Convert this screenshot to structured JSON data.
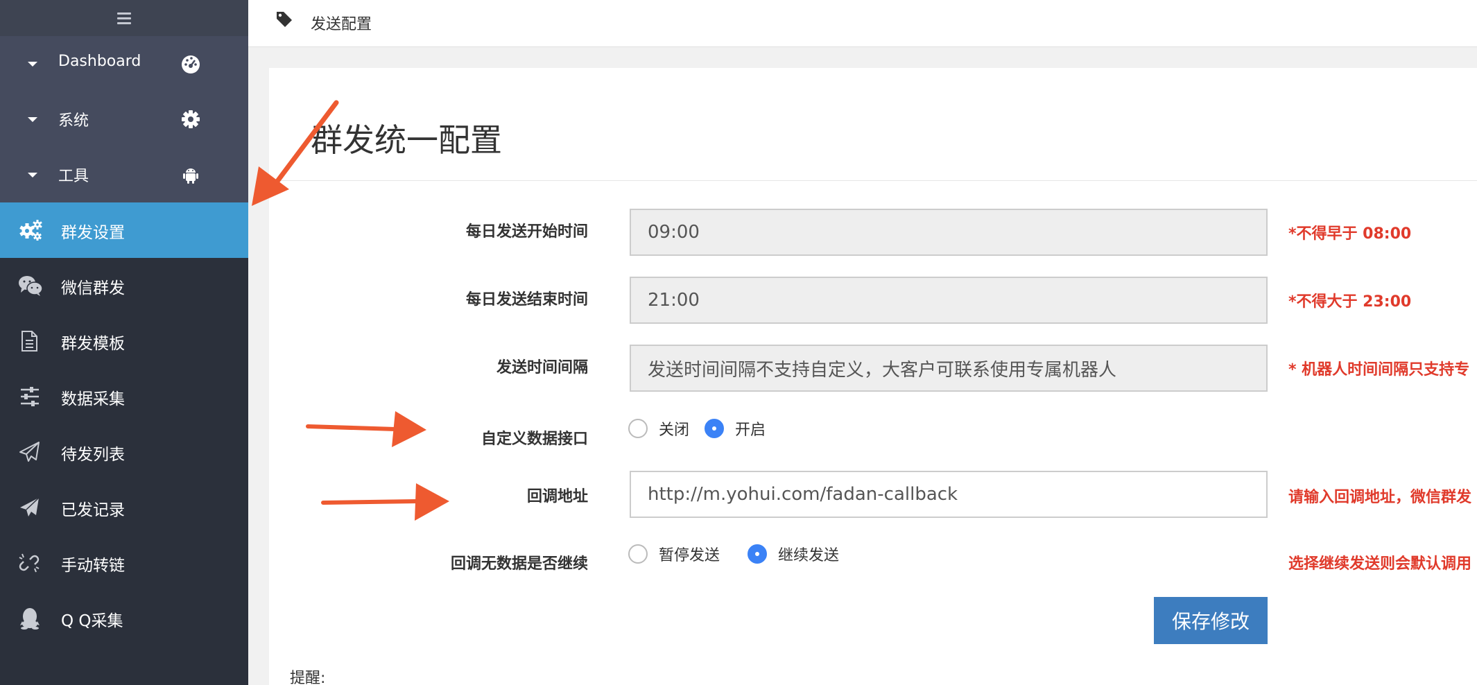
{
  "sidebar": {
    "groups": [
      {
        "label": "Dashboard",
        "icon": "dashboard-icon"
      },
      {
        "label": "系统",
        "icon": "gear-icon"
      },
      {
        "label": "工具",
        "icon": "android-icon"
      }
    ],
    "items": [
      {
        "label": "群发设置",
        "icon": "cogs-icon",
        "active": true
      },
      {
        "label": "微信群发",
        "icon": "wechat-icon",
        "active": false
      },
      {
        "label": "群发模板",
        "icon": "file-text-icon",
        "active": false
      },
      {
        "label": "数据采集",
        "icon": "sliders-icon",
        "active": false
      },
      {
        "label": "待发列表",
        "icon": "paper-plane-outline-icon",
        "active": false
      },
      {
        "label": "已发记录",
        "icon": "paper-plane-icon",
        "active": false
      },
      {
        "label": "手动转链",
        "icon": "unlink-icon",
        "active": false
      },
      {
        "label": "Q Q采集",
        "icon": "qq-icon",
        "active": false
      }
    ]
  },
  "header": {
    "breadcrumb": "发送配置",
    "icon": "tag-icon"
  },
  "panel": {
    "title": "群发统一配置",
    "fields": {
      "start_time": {
        "label": "每日发送开始时间",
        "value": "09:00",
        "hint": "*不得早于 08:00"
      },
      "end_time": {
        "label": "每日发送结束时间",
        "value": "21:00",
        "hint": "*不得大于 23:00"
      },
      "interval": {
        "label": "发送时间间隔",
        "value": "发送时间间隔不支持自定义，大客户可联系使用专属机器人",
        "hint": "* 机器人时间间隔只支持专"
      },
      "custom_api": {
        "label": "自定义数据接口",
        "options": [
          "关闭",
          "开启"
        ],
        "selected": "开启"
      },
      "callback_url": {
        "label": "回调地址",
        "value": "http://m.yohui.com/fadan-callback",
        "hint": "请输入回调地址，微信群发"
      },
      "callback_empty": {
        "label": "回调无数据是否继续",
        "options": [
          "暂停发送",
          "继续发送"
        ],
        "selected": "继续发送",
        "hint": "选择继续发送则会默认调用"
      }
    },
    "save_label": "保存修改",
    "notice_label": "提醒:"
  },
  "colors": {
    "sidebar_bg": "#2b303b",
    "group_bg": "#454b5e",
    "active_bg": "#3f9bd1",
    "hint_red": "#e03a2b",
    "save_btn": "#3d7dbf",
    "annotation_arrow": "#ee5a30"
  }
}
